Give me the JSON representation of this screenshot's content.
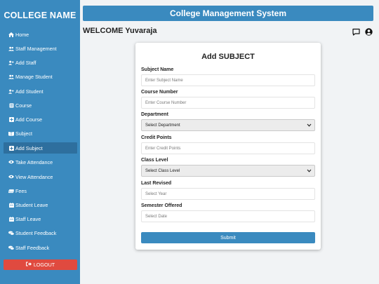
{
  "sidebar": {
    "brand": "COLLEGE NAME",
    "items": [
      {
        "label": "Home",
        "icon": "home-icon"
      },
      {
        "label": "Staff Management",
        "icon": "users-icon"
      },
      {
        "label": "Add Staff",
        "icon": "user-plus-icon"
      },
      {
        "label": "Manage Student",
        "icon": "users-icon"
      },
      {
        "label": "Add Student",
        "icon": "user-plus-icon"
      },
      {
        "label": "Course",
        "icon": "book-icon"
      },
      {
        "label": "Add Course",
        "icon": "plus-square-icon"
      },
      {
        "label": "Subject",
        "icon": "book-open-icon"
      },
      {
        "label": "Add Subject",
        "icon": "plus-square-icon",
        "active": true
      },
      {
        "label": "Take Attendance",
        "icon": "eye-icon"
      },
      {
        "label": "View Attendance",
        "icon": "eye-icon"
      },
      {
        "label": "Fees",
        "icon": "money-icon"
      },
      {
        "label": "Student Leave",
        "icon": "calendar-icon"
      },
      {
        "label": "Staff Leave",
        "icon": "calendar-icon"
      },
      {
        "label": "Student Feedback",
        "icon": "comments-icon"
      },
      {
        "label": "Staff Feedback",
        "icon": "comments-icon"
      }
    ],
    "logout_label": "LOGOUT"
  },
  "header": {
    "title": "College Management System",
    "welcome": "WELCOME Yuvaraja"
  },
  "form": {
    "title": "Add SUBJECT",
    "subject_name_label": "Subject Name",
    "subject_name_placeholder": "Enter Subject Name",
    "course_number_label": "Course Number",
    "course_number_placeholder": "Enter Course Number",
    "department_label": "Department",
    "department_selected": "Select Department",
    "credit_points_label": "Credit Points",
    "credit_points_placeholder": "Enter Credit Points",
    "class_level_label": "Class Level",
    "class_level_selected": "Select Class Level",
    "last_revised_label": "Last Revised",
    "last_revised_placeholder": "Select Year",
    "semester_offered_label": "Semester Offered",
    "semester_offered_placeholder": "Select Date",
    "submit_label": "Submit"
  },
  "colors": {
    "primary": "#3a8abf",
    "sidebar_active": "#2e6f9e",
    "logout": "#e04a3f",
    "background": "#f1f3f5"
  }
}
